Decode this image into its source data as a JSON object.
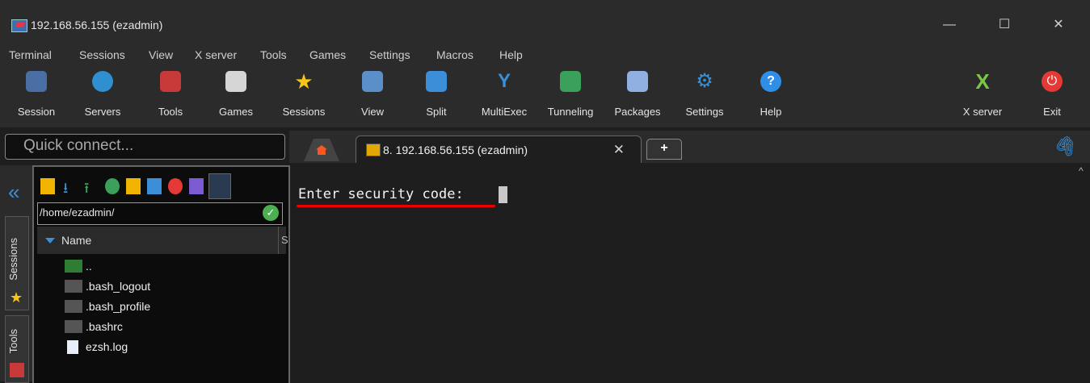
{
  "window": {
    "title": "192.168.56.155 (ezadmin)",
    "minimize_icon": "—",
    "maximize_icon": "☐",
    "close_icon": "✕"
  },
  "menubar": [
    "Terminal",
    "Sessions",
    "View",
    "X server",
    "Tools",
    "Games",
    "Settings",
    "Macros",
    "Help"
  ],
  "toolbar": {
    "items": [
      {
        "label": "Session",
        "icon": "session-icon"
      },
      {
        "label": "Servers",
        "icon": "servers-icon"
      },
      {
        "label": "Tools",
        "icon": "tools-icon"
      },
      {
        "label": "Games",
        "icon": "games-icon"
      },
      {
        "label": "Sessions",
        "icon": "star-icon"
      },
      {
        "label": "View",
        "icon": "view-icon"
      },
      {
        "label": "Split",
        "icon": "split-icon"
      },
      {
        "label": "MultiExec",
        "icon": "multiexec-icon"
      },
      {
        "label": "Tunneling",
        "icon": "tunneling-icon"
      },
      {
        "label": "Packages",
        "icon": "packages-icon"
      },
      {
        "label": "Settings",
        "icon": "settings-icon"
      },
      {
        "label": "Help",
        "icon": "help-icon"
      }
    ],
    "xserver_label": "X server",
    "exit_label": "Exit"
  },
  "quick_connect": {
    "placeholder": "Quick connect..."
  },
  "tabs": {
    "home_icon": "home-icon",
    "session_tab": "8. 192.168.56.155 (ezadmin)",
    "close": "✕",
    "new_tab": "+"
  },
  "side_tabs": {
    "sessions": "Sessions",
    "tools": "Tools",
    "collapse": "«"
  },
  "sftp": {
    "path": "/home/ezadmin/",
    "path_ok": "✓",
    "column_name": "Name",
    "column_size_partial": "S",
    "files": [
      {
        "name": "..",
        "icon": "parent-folder-icon"
      },
      {
        "name": ".bash_logout",
        "icon": "file-icon"
      },
      {
        "name": ".bash_profile",
        "icon": "file-icon"
      },
      {
        "name": ".bashrc",
        "icon": "file-icon"
      },
      {
        "name": "ezsh.log",
        "icon": "log-file-icon"
      }
    ]
  },
  "terminal": {
    "prompt": "Enter security code: ",
    "scroll_up": "^"
  },
  "colors": {
    "accent": "#3a8fd8",
    "highlight_underline": "#e00000",
    "background": "#1e1e1e"
  }
}
